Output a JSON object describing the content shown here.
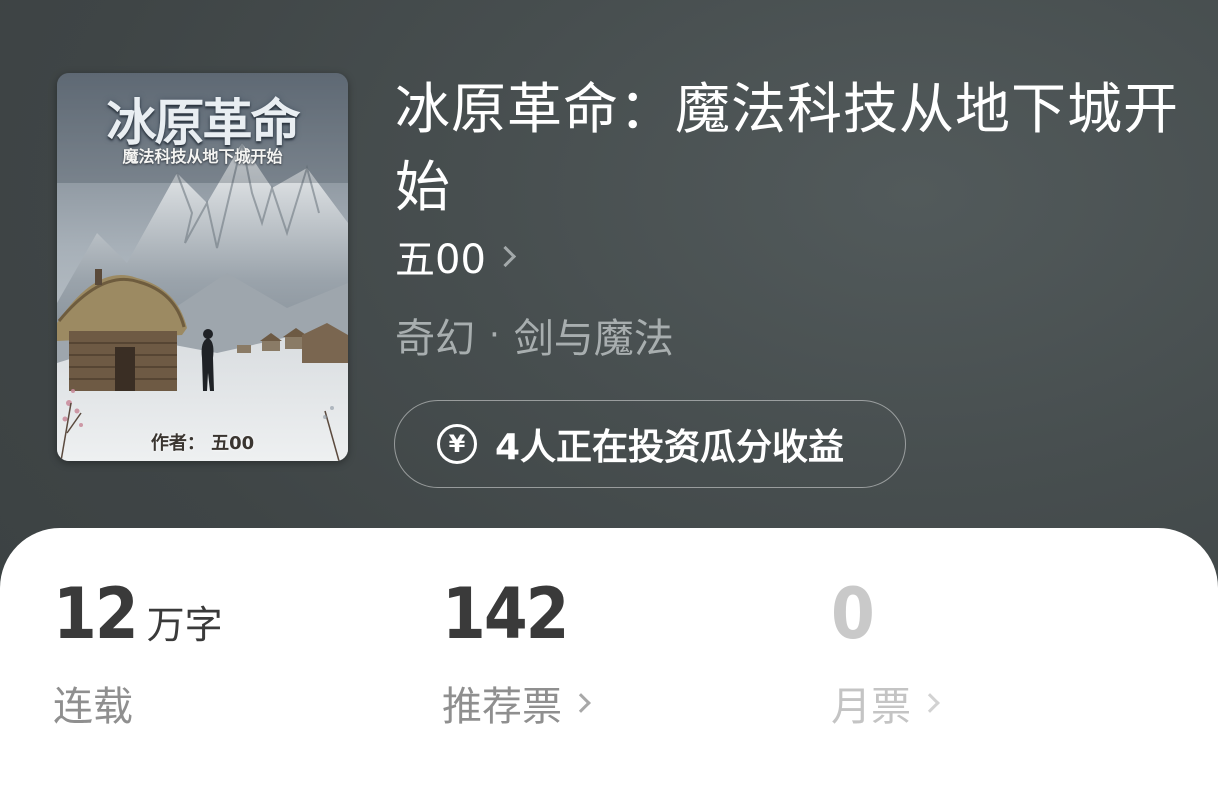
{
  "book": {
    "title": "冰原革命：魔法科技从地下城开始",
    "author": "五00",
    "genre_primary": "奇幻",
    "genre_separator": "·",
    "genre_secondary": "剑与魔法",
    "investment_text": "4人正在投资瓜分收益",
    "investment_icon": "yen-circle-icon"
  },
  "cover": {
    "title": "冰原革命",
    "subtitle": "魔法科技从地下城开始",
    "author_line": "作者：  五00"
  },
  "stats": {
    "words": {
      "value": "12",
      "unit": "万字",
      "label": "连载"
    },
    "recommend": {
      "value": "142",
      "label": "推荐票"
    },
    "monthly": {
      "value": "0",
      "label": "月票"
    }
  },
  "colors": {
    "header_background": "#454c4d",
    "card_background": "#ffffff",
    "primary_text": "#3a3a3a",
    "secondary_text": "#8f8f8f",
    "disabled_text": "#c9c9c9"
  }
}
